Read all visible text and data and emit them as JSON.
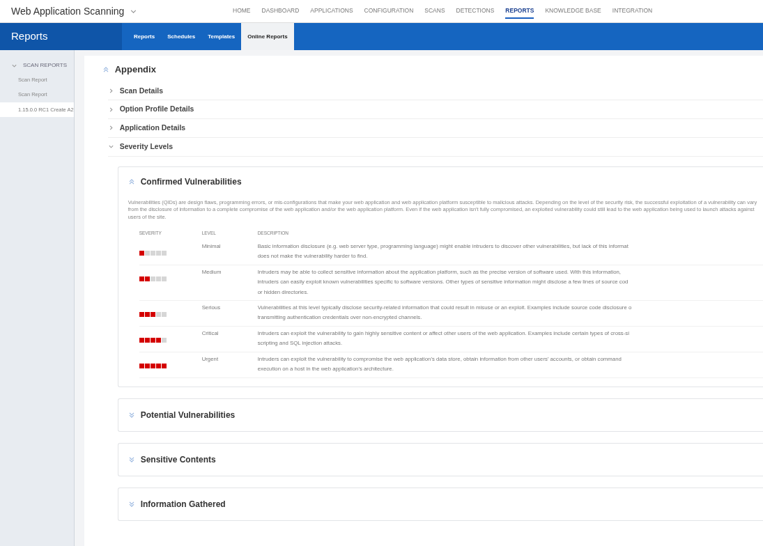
{
  "app": {
    "title": "Web Application Scanning"
  },
  "nav": [
    {
      "label": "HOME",
      "selected": false
    },
    {
      "label": "DASHBOARD",
      "selected": false
    },
    {
      "label": "APPLICATIONS",
      "selected": false
    },
    {
      "label": "CONFIGURATION",
      "selected": false
    },
    {
      "label": "SCANS",
      "selected": false
    },
    {
      "label": "DETECTIONS",
      "selected": false
    },
    {
      "label": "REPORTS",
      "selected": true
    },
    {
      "label": "KNOWLEDGE BASE",
      "selected": false
    },
    {
      "label": "INTEGRATION",
      "selected": false
    }
  ],
  "section_title": "Reports",
  "tabs": [
    {
      "label": "Reports",
      "selected": false
    },
    {
      "label": "Schedules",
      "selected": false
    },
    {
      "label": "Templates",
      "selected": false
    },
    {
      "label": "Online Reports",
      "selected": true
    }
  ],
  "sidebar": {
    "group": "SCAN REPORTS",
    "expanded": true,
    "items": [
      {
        "label": "Scan Report",
        "selected": false
      },
      {
        "label": "Scan Report",
        "selected": false
      },
      {
        "label": "1.15.0.0 RC1 Create A2",
        "selected": true
      }
    ]
  },
  "appendix": {
    "title": "Appendix",
    "expanded": true,
    "sections": [
      {
        "title": "Scan Details",
        "expanded": false
      },
      {
        "title": "Option Profile Details",
        "expanded": false
      },
      {
        "title": "Application Details",
        "expanded": false
      },
      {
        "title": "Severity Levels",
        "expanded": true
      }
    ],
    "cards": [
      {
        "title": "Confirmed Vulnerabilities",
        "expanded": true,
        "intro": "Vulnerabilities (QIDs) are design flaws, programming errors, or mis-configurations that make your web application and web application platform susceptible to malicious attacks. Depending on the level of the security risk, the successful exploitation of a vulnerability can vary from the disclosure of information to a complete compromise of the web application and/or the web application platform. Even if the web application isn't fully compromised, an exploited vulnerability could still lead to the web application being used to launch attacks against users of the site.",
        "columns": [
          "SEVERITY",
          "LEVEL",
          "DESCRIPTION"
        ],
        "rows": [
          {
            "stars": 1,
            "name": "Minimal",
            "lines": [
              "Basic information disclosure (e.g. web server type, programming language) might enable intruders to discover other vulnerabilities, but lack of this informat",
              "does not make the vulnerability harder to find."
            ]
          },
          {
            "stars": 2,
            "name": "Medium",
            "lines": [
              "Intruders may be able to collect sensitive information about the application platform, such as the precise version of software used. With this information,",
              "intruders can easily exploit known vulnerabilities specific to software versions. Other types of sensitive information might disclose a few lines of source cod",
              "or hidden directories."
            ]
          },
          {
            "stars": 3,
            "name": "Serious",
            "lines": [
              "Vulnerabilities at this level typically disclose security-related information that could result in misuse or an exploit. Examples include source code disclosure o",
              "transmitting authentication credentials over non-encrypted channels."
            ]
          },
          {
            "stars": 4,
            "name": "Critical",
            "lines": [
              "Intruders can exploit the vulnerability to gain highly sensitive content or affect other users of the web application. Examples include certain types of cross-si",
              "scripting and SQL injection attacks."
            ]
          },
          {
            "stars": 5,
            "name": "Urgent",
            "lines": [
              "Intruders can exploit the vulnerability to compromise the web application's data store, obtain information from other users' accounts, or obtain command",
              "execution on a host in the web application's architecture."
            ]
          }
        ]
      },
      {
        "title": "Potential Vulnerabilities",
        "expanded": false
      },
      {
        "title": "Sensitive Contents",
        "expanded": false
      },
      {
        "title": "Information Gathered",
        "expanded": false
      }
    ]
  }
}
